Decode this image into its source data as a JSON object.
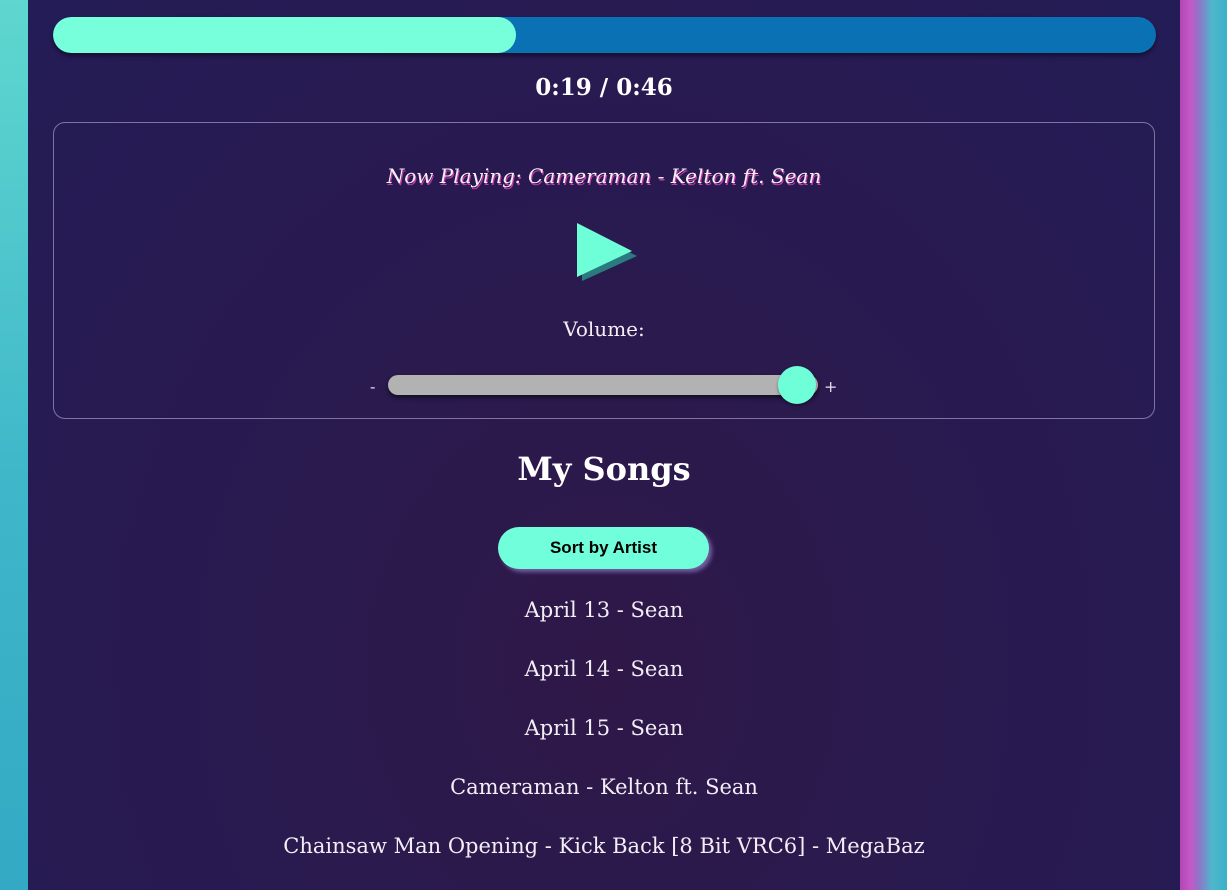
{
  "player": {
    "progress_fraction": 0.42,
    "time_display": "0:19 / 0:46",
    "now_playing": "Now Playing: Cameraman - Kelton ft. Sean",
    "play_icon": "play-icon",
    "volume_label": "Volume:",
    "volume_min_label": "-",
    "volume_max_label": "+",
    "volume_fraction": 0.95
  },
  "songs": {
    "title": "My Songs",
    "sort_button_label": "Sort by Artist",
    "items": [
      "April 13 - Sean",
      "April 14 - Sean",
      "April 15 - Sean",
      "Cameraman - Kelton ft. Sean",
      "Chainsaw Man Opening - Kick Back [8 Bit VRC6] - MegaBaz"
    ]
  },
  "colors": {
    "accent": "#77ffdc",
    "progress_track": "#0a72b4",
    "panel_bg": "#291a4f",
    "page_bg": "#3fb6c9",
    "now_playing_shadow": "#c23aa3"
  }
}
